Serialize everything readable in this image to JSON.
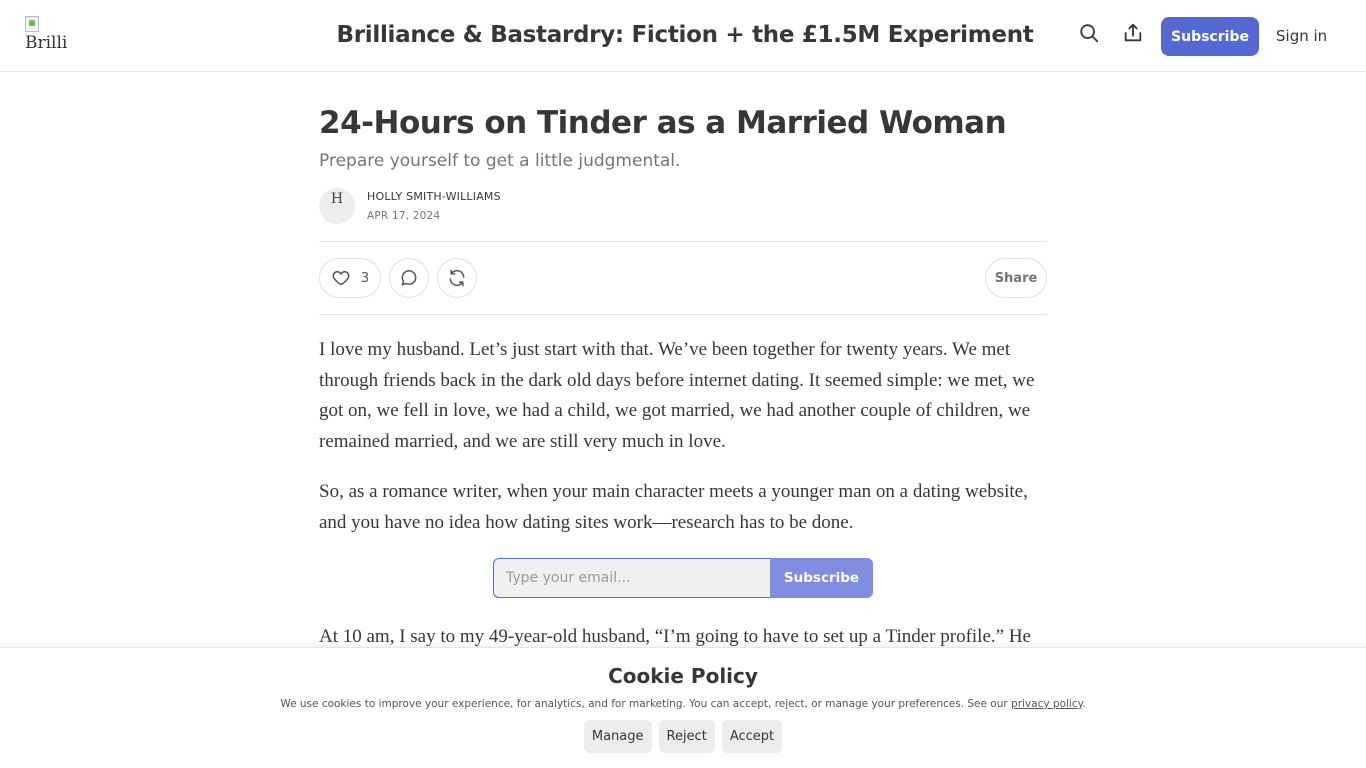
{
  "header": {
    "logo_alt": "Brilli",
    "publication_title": "Brilliance & Bastardry: Fiction + the £1.5M Experiment",
    "subscribe_label": "Subscribe",
    "signin_label": "Sign in",
    "accent_color": "#5469d4"
  },
  "post": {
    "title": "24-Hours on Tinder as a Married Woman",
    "subtitle": "Prepare yourself to get a little judgmental.",
    "avatar_alt": "H",
    "author": "HOLLY SMITH-WILLIAMS",
    "date": "APR 17, 2024",
    "like_count": "3",
    "share_label": "Share",
    "paragraphs": [
      "I love my husband. Let’s just start with that. We’ve been together for twenty years. We met through friends back in the dark old days before internet dating. It seemed simple: we met, we got on, we fell in love, we had a child, we got married, we had another couple of children, we remained married, and we are still very much in love.",
      "So, as a romance writer, when your main character meets a younger man on a dating website, and you have no idea how dating sites work—research has to be done.",
      "At 10 am, I say to my 49-year-old husband, “I’m going to have to set up a Tinder profile.” He"
    ],
    "subscribe_form": {
      "email_placeholder": "Type your email...",
      "button_label": "Subscribe"
    }
  },
  "cookie_banner": {
    "title": "Cookie Policy",
    "text": "We use cookies to improve your experience, for analytics, and for marketing. You can accept, reject, or manage your preferences. See our ",
    "link_text": "privacy policy",
    "text_end": ".",
    "manage_label": "Manage",
    "reject_label": "Reject",
    "accept_label": "Accept"
  }
}
